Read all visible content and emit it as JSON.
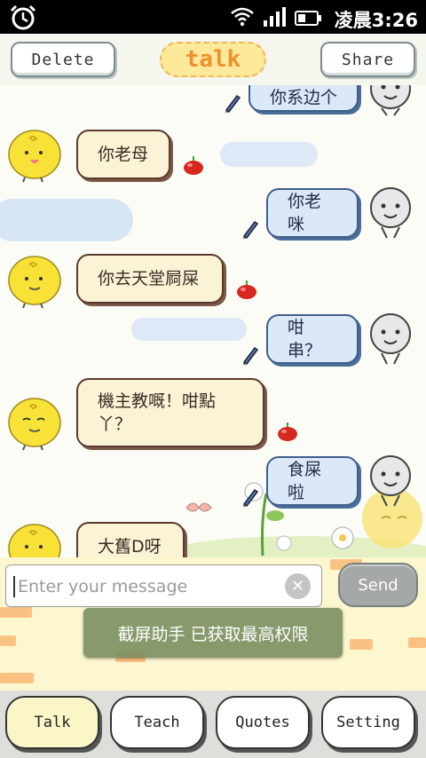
{
  "status_bar": {
    "time": "凌晨3:26",
    "icons": [
      "alarm-icon",
      "wifi-icon",
      "signal-icon",
      "battery-icon"
    ]
  },
  "header": {
    "delete_label": "Delete",
    "title": "talk",
    "share_label": "Share"
  },
  "messages": [
    {
      "side": "right",
      "text": "你系边个"
    },
    {
      "side": "left",
      "text": "你老母"
    },
    {
      "side": "right",
      "text": "你老咪"
    },
    {
      "side": "left",
      "text": "你去天堂屙屎"
    },
    {
      "side": "right",
      "text": "咁串？"
    },
    {
      "side": "left",
      "text": "機主教嘅！咁點\n丫？"
    },
    {
      "side": "right",
      "text": "食屎啦"
    },
    {
      "side": "left",
      "text": "大舊D呀"
    }
  ],
  "input": {
    "placeholder": "Enter your message",
    "send_label": "Send"
  },
  "toast": "截屏助手 已获取最高权限",
  "nav": {
    "items": [
      "Talk",
      "Teach",
      "Quotes",
      "Setting"
    ],
    "active": "Talk"
  },
  "colors": {
    "accent": "#f08f2e",
    "left_bubble": "#fbf3d6",
    "right_bubble": "#dbe8f8",
    "toast": "#7f9a5f"
  }
}
